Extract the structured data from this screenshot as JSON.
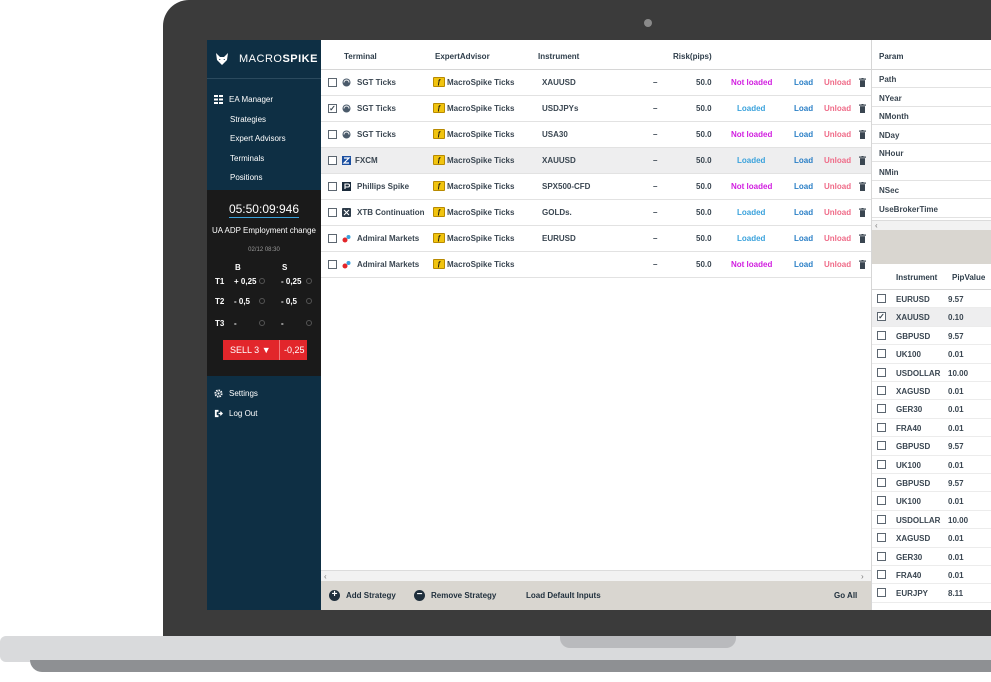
{
  "app": {
    "brand_regular": "MACRO",
    "brand_bold": "SPIKE"
  },
  "sidebar": {
    "nav": [
      {
        "label": "EA Manager",
        "icon": "grid-icon"
      },
      {
        "label": "Strategies"
      },
      {
        "label": "Expert Advisors"
      },
      {
        "label": "Terminals"
      },
      {
        "label": "Positions"
      }
    ],
    "clock": "05:50:09:946",
    "event": "UA ADP Employment change",
    "event_date": "02/12 08:30",
    "buy_header": "B",
    "sell_header": "S",
    "rows": [
      {
        "label": "T1",
        "buy": "+ 0,25",
        "sell": "- 0,25"
      },
      {
        "label": "T2",
        "buy": "- 0,5",
        "sell": "- 0,5"
      },
      {
        "label": "T3",
        "buy": "-",
        "sell": "-"
      }
    ],
    "sell_button": "SELL 3 ▼",
    "sell_value": "-0,25",
    "settings": "Settings",
    "logout": "Log Out"
  },
  "table": {
    "headers": {
      "terminal": "Terminal",
      "ea": "ExpertAdvisor",
      "instrument": "Instrument",
      "risk": "Risk(pips)"
    },
    "rows": [
      {
        "checked": false,
        "terminal": "SGT Ticks",
        "term_icon": "sgt",
        "ea": "MacroSpike Ticks",
        "instrument": "XAUUSD",
        "dash": "–",
        "risk": "50.0",
        "status": "Not loaded",
        "load": "Load",
        "unload": "Unload"
      },
      {
        "checked": true,
        "terminal": "SGT Ticks",
        "term_icon": "sgt",
        "ea": "MacroSpike Ticks",
        "instrument": "USDJPYs",
        "dash": "–",
        "risk": "50.0",
        "status": "Loaded",
        "load": "Load",
        "unload": "Unload"
      },
      {
        "checked": false,
        "terminal": "SGT Ticks",
        "term_icon": "sgt",
        "ea": "MacroSpike Ticks",
        "instrument": "USA30",
        "dash": "–",
        "risk": "50.0",
        "status": "Not loaded",
        "load": "Load",
        "unload": "Unload"
      },
      {
        "checked": false,
        "terminal": "FXCM",
        "term_icon": "fxcm",
        "ea": "MacroSpike Ticks",
        "instrument": "XAUUSD",
        "dash": "–",
        "risk": "50.0",
        "status": "Loaded",
        "load": "Load",
        "unload": "Unload"
      },
      {
        "checked": false,
        "terminal": "Phillips Spike",
        "term_icon": "phillips",
        "ea": "MacroSpike Ticks",
        "instrument": "SPX500-CFD",
        "dash": "–",
        "risk": "50.0",
        "status": "Not loaded",
        "load": "Load",
        "unload": "Unload"
      },
      {
        "checked": false,
        "terminal": "XTB Continuation",
        "term_icon": "xtb",
        "ea": "MacroSpike Ticks",
        "instrument": "GOLDs.",
        "dash": "–",
        "risk": "50.0",
        "status": "Loaded",
        "load": "Load",
        "unload": "Unload"
      },
      {
        "checked": false,
        "terminal": "Admiral Markets",
        "term_icon": "admiral",
        "ea": "MacroSpike Ticks",
        "instrument": "EURUSD",
        "dash": "–",
        "risk": "50.0",
        "status": "Loaded",
        "load": "Load",
        "unload": "Unload"
      },
      {
        "checked": false,
        "terminal": "Admiral Markets",
        "term_icon": "admiral",
        "ea": "MacroSpike Ticks",
        "instrument": "",
        "dash": "–",
        "risk": "50.0",
        "status": "Not loaded",
        "load": "Load",
        "unload": "Unload"
      }
    ],
    "highlight_row": 3
  },
  "footer": {
    "add": "Add Strategy",
    "remove": "Remove Strategy",
    "load_defaults": "Load Default Inputs",
    "go_all": "Go All"
  },
  "params": {
    "header": "Param",
    "items": [
      "Path",
      "NYear",
      "NMonth",
      "NDay",
      "NHour",
      "NMin",
      "NSec",
      "UseBrokerTime"
    ]
  },
  "instruments": {
    "headers": {
      "instrument": "Instrument",
      "pip": "PipValue"
    },
    "rows": [
      {
        "checked": false,
        "name": "EURUSD",
        "pip": "9.57"
      },
      {
        "checked": true,
        "name": "XAUUSD",
        "pip": "0.10"
      },
      {
        "checked": false,
        "name": "GBPUSD",
        "pip": "9.57"
      },
      {
        "checked": false,
        "name": "UK100",
        "pip": "0.01"
      },
      {
        "checked": false,
        "name": "USDOLLAR",
        "pip": "10.00"
      },
      {
        "checked": false,
        "name": "XAGUSD",
        "pip": "0.01"
      },
      {
        "checked": false,
        "name": "GER30",
        "pip": "0.01"
      },
      {
        "checked": false,
        "name": "FRA40",
        "pip": "0.01"
      },
      {
        "checked": false,
        "name": "GBPUSD",
        "pip": "9.57"
      },
      {
        "checked": false,
        "name": "UK100",
        "pip": "0.01"
      },
      {
        "checked": false,
        "name": "GBPUSD",
        "pip": "9.57"
      },
      {
        "checked": false,
        "name": "UK100",
        "pip": "0.01"
      },
      {
        "checked": false,
        "name": "USDOLLAR",
        "pip": "10.00"
      },
      {
        "checked": false,
        "name": "XAGUSD",
        "pip": "0.01"
      },
      {
        "checked": false,
        "name": "GER30",
        "pip": "0.01"
      },
      {
        "checked": false,
        "name": "FRA40",
        "pip": "0.01"
      },
      {
        "checked": false,
        "name": "EURJPY",
        "pip": "8.11"
      }
    ],
    "highlight_row": 1
  },
  "colors": {
    "sidebar": "#0e2f44",
    "not_loaded": "#d11ee0",
    "loaded": "#3aa2dc",
    "sell": "#e2262b"
  }
}
